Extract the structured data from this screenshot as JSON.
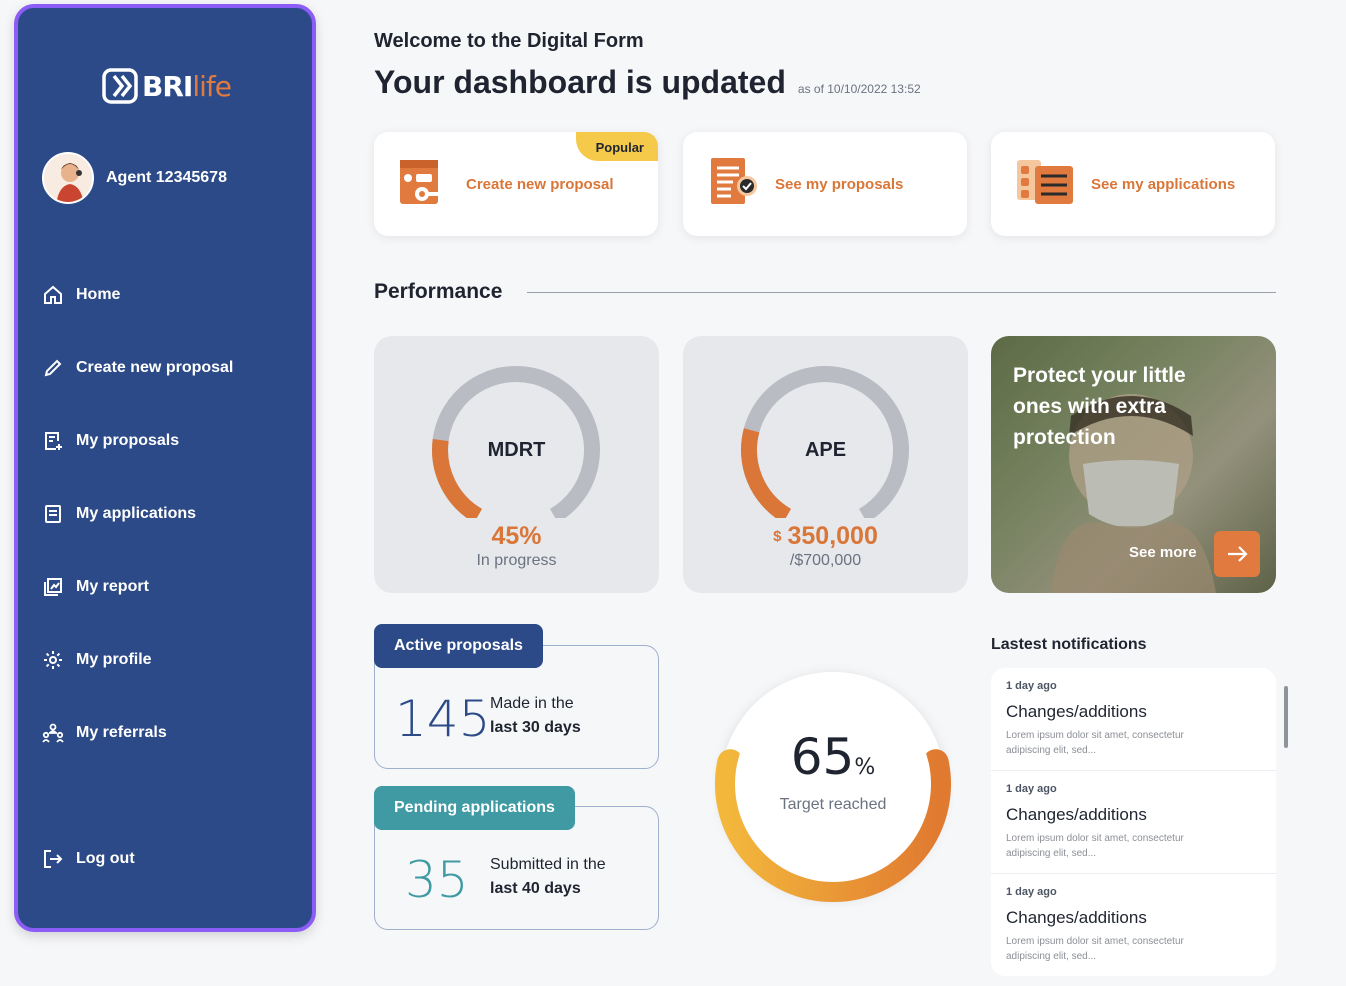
{
  "brand": {
    "part1": "BRI",
    "part2": "life"
  },
  "agent": {
    "name": "Agent 12345678"
  },
  "nav": [
    {
      "label": "Home",
      "icon": "home-icon"
    },
    {
      "label": "Create new proposal",
      "icon": "pencil-icon"
    },
    {
      "label": "My proposals",
      "icon": "document-add-icon"
    },
    {
      "label": "My applications",
      "icon": "document-icon"
    },
    {
      "label": "My report",
      "icon": "chart-icon"
    },
    {
      "label": "My profile",
      "icon": "gear-icon"
    },
    {
      "label": "My referrals",
      "icon": "people-icon"
    }
  ],
  "logout": {
    "label": "Log out",
    "icon": "logout-icon"
  },
  "header": {
    "welcome": "Welcome to the Digital Form",
    "title": "Your dashboard is updated",
    "as_of": "as of 10/10/2022 13:52"
  },
  "actions": [
    {
      "label": "Create new proposal",
      "badge": "Popular",
      "icon": "proposal-machine-icon"
    },
    {
      "label": "See my proposals",
      "icon": "checked-document-icon"
    },
    {
      "label": "See my applications",
      "icon": "application-list-icon"
    }
  ],
  "performance": {
    "title": "Performance",
    "mdrt": {
      "name": "MDRT",
      "value": "45%",
      "sub": "In progress",
      "progress": 0.45
    },
    "ape": {
      "name": "APE",
      "currency": "$",
      "value": "350,000",
      "sub": "/$700,000",
      "progress": 0.5
    },
    "promo": {
      "text": "Protect your little ones with extra protection",
      "link": "See more"
    }
  },
  "stats": {
    "active": {
      "tab": "Active proposals",
      "number": "145",
      "line1": "Made in the",
      "line2": "last 30 days"
    },
    "pending": {
      "tab": "Pending applications",
      "number": "35",
      "line1": "Submitted in the",
      "line2": "last 40 days"
    }
  },
  "target": {
    "value": "65",
    "unit": "%",
    "label": "Target reached",
    "progress": 0.65
  },
  "notifications": {
    "title": "Lastest notifications",
    "items": [
      {
        "time": "1 day ago",
        "title": "Changes/additions",
        "body": "Lorem ipsum dolor sit amet, consectetur adipiscing elit, sed..."
      },
      {
        "time": "1 day ago",
        "title": "Changes/additions",
        "body": "Lorem ipsum dolor sit amet, consectetur adipiscing elit, sed..."
      },
      {
        "time": "1 day ago",
        "title": "Changes/additions",
        "body": "Lorem ipsum dolor sit amet, consectetur adipiscing elit, sed..."
      }
    ]
  },
  "colors": {
    "sidebar": "#2c4a87",
    "accent": "#d97638",
    "teal": "#3f9aa3",
    "badge": "#f5c94a"
  }
}
